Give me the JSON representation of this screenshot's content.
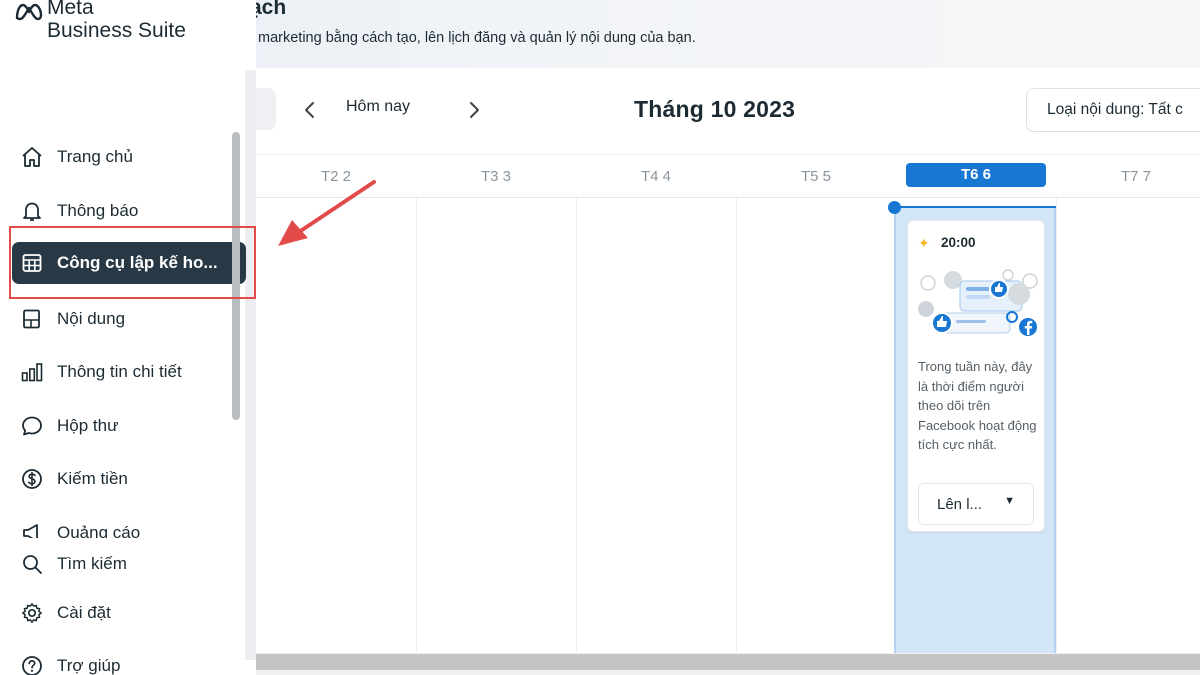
{
  "app": {
    "logo_line1": "Meta",
    "logo_line2": "Business Suite"
  },
  "header": {
    "title_fragment": "ạch",
    "subtitle": "marketing bằng cách tạo, lên lịch đăng và quản lý nội dung của bạn."
  },
  "sidebar": {
    "items": [
      {
        "label": "Trang chủ",
        "icon": "home-icon"
      },
      {
        "label": "Thông báo",
        "icon": "bell-icon"
      },
      {
        "label": "Công cụ lập kế ho...",
        "icon": "calendar-grid-icon",
        "active": true
      },
      {
        "label": "Nội dung",
        "icon": "content-icon"
      },
      {
        "label": "Thông tin chi tiết",
        "icon": "bar-chart-icon"
      },
      {
        "label": "Hộp thư",
        "icon": "chat-bubble-icon"
      },
      {
        "label": "Kiếm tiền",
        "icon": "dollar-icon"
      },
      {
        "label": "Quảng cáo",
        "icon": "megaphone-icon"
      }
    ],
    "bottom_items": [
      {
        "label": "Tìm kiếm",
        "icon": "search-icon"
      },
      {
        "label": "Cài đặt",
        "icon": "gear-icon"
      },
      {
        "label": "Trợ giúp",
        "icon": "help-icon"
      }
    ]
  },
  "toolbar": {
    "today_label": "Hôm nay",
    "month_title": "Tháng 10 2023",
    "content_type_label": "Loại nội dung: Tất c"
  },
  "days": [
    "T2 2",
    "T3 3",
    "T4 4",
    "T5 5",
    "T6 6",
    "T7 7"
  ],
  "active_day_index": 4,
  "tip_card": {
    "time": "20:00",
    "text": "Trong tuần này, đây là thời điểm người theo dõi trên Facebook hoạt động tích cực nhất.",
    "button_label": "Lên l..."
  },
  "colors": {
    "accent": "#1877d2",
    "sidebar_active_bg": "#283845",
    "annotation_red": "#e34a4a",
    "highlight_column": "#d3e6f7"
  }
}
